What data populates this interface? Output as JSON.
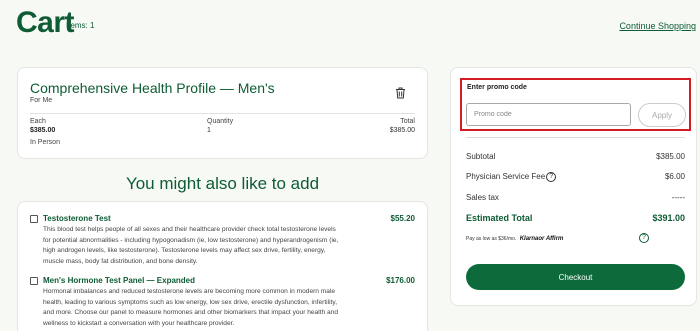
{
  "header": {
    "title": "Cart",
    "items_count": "Items: 1",
    "continue_link": "Continue Shopping"
  },
  "product": {
    "name": "Comprehensive Health Profile — Men's",
    "subtitle": "For Me",
    "each_label": "Each",
    "each_value": "$385.00",
    "format": "In Person",
    "quantity_label": "Quantity",
    "quantity_value": "1",
    "total_label": "Total",
    "total_value": "$385.00",
    "icon": "trash-icon"
  },
  "suggestions": {
    "title": "You might also like to add",
    "items": [
      {
        "name": "Testosterone Test",
        "price": "$55.20",
        "description": "This blood test helps people of all sexes and their healthcare provider check total testosterone levels for potential abnormalities - including hypogonadism (ie, low testosterone) and hyperandrogenism (ie, high androgen levels, like testosterone). Testosterone levels may affect sex drive, fertility, energy, muscle mass, body fat distribution, and bone density."
      },
      {
        "name": "Men's Hormone Test Panel — Expanded",
        "price": "$176.00",
        "description": "Hormonal imbalances and reduced testosterone levels are becoming more common in modern male health, leading to various symptoms such as low energy, low sex drive, erectile dysfunction, infertility, and more. Choose our panel to measure hormones and other biomarkers that impact your health and wellness to kickstart a conversation with your healthcare provider."
      }
    ]
  },
  "summary": {
    "promo_label": "Enter promo code",
    "promo_placeholder": "Promo code",
    "apply_label": "Apply",
    "subtotal_label": "Subtotal",
    "subtotal_value": "$385.00",
    "fee_label": "Physician Service Fee",
    "fee_value": "$6.00",
    "tax_label": "Sales tax",
    "tax_value": "-----",
    "total_label": "Estimated Total",
    "total_value": "$391.00",
    "affirm_text": "Pay as low as $36/mo.",
    "affirm_brand": "Klarnaor Affirm",
    "checkout_label": "Checkout",
    "accent_color": "#0d6b3b",
    "highlight_color": "#d51c24"
  }
}
